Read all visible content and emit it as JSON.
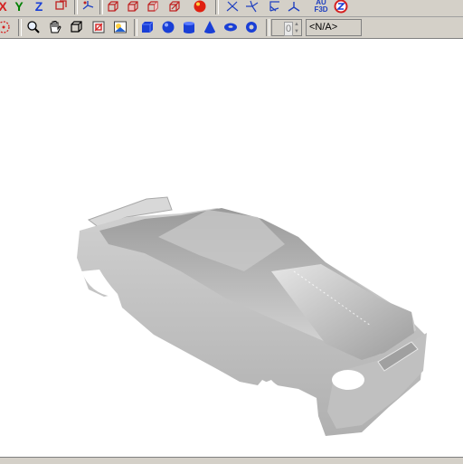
{
  "toolbar_top": {
    "axis_x": "X",
    "axis_y": "Y",
    "axis_z": "Z",
    "badge_a": "AU",
    "badge_b": "F3D"
  },
  "toolbar_bottom": {
    "stepper_value": "0",
    "view_combo_value": "<N/A>"
  },
  "viewport": {
    "model_icon": "car-body-model"
  },
  "colors": {
    "toolbar_bg": "#d4d0c8",
    "accent_blue": "#1a3fd6",
    "accent_red": "#d42020",
    "axis_green": "#008000",
    "model_gray": "#b8b8b8"
  }
}
